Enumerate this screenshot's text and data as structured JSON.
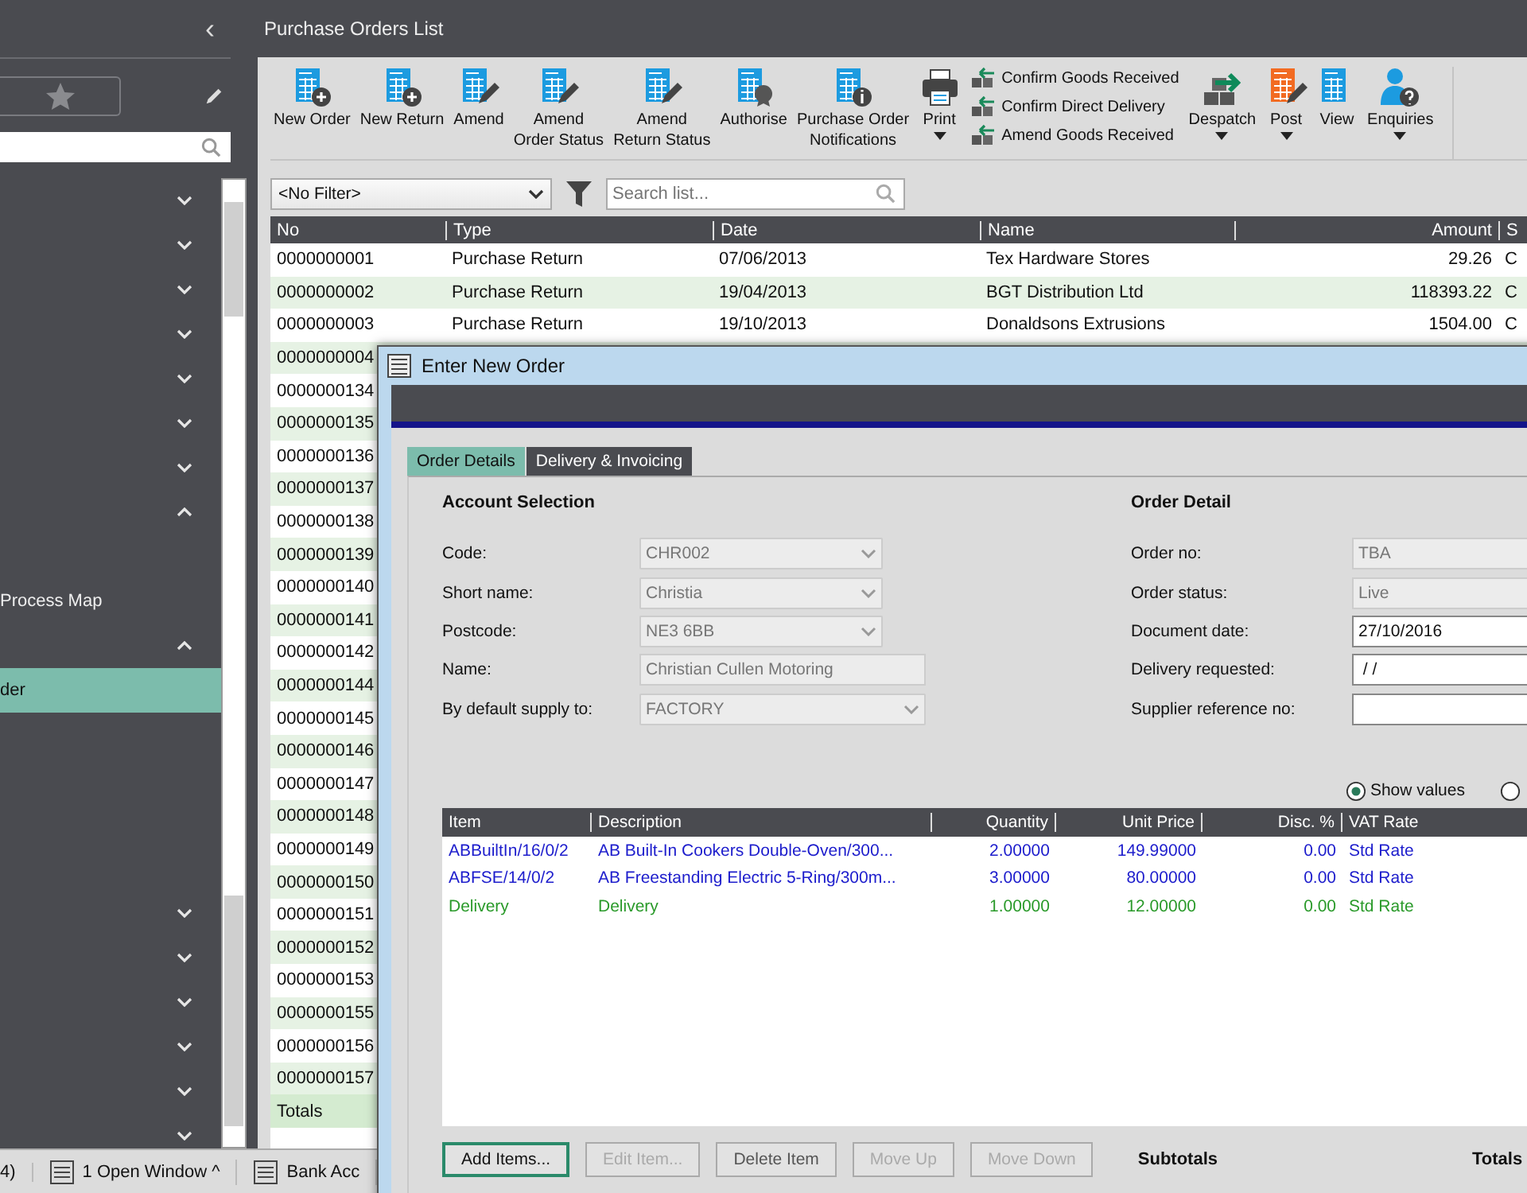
{
  "sidebar": {
    "collapse_glyph": "‹",
    "items": [
      {
        "expanded": false
      },
      {
        "expanded": false
      },
      {
        "expanded": false
      },
      {
        "expanded": false
      },
      {
        "expanded": false
      },
      {
        "expanded": false
      },
      {
        "expanded": false
      },
      {
        "expanded": true
      },
      {
        "selected": false
      },
      {
        "label": "Process Map",
        "selected": false
      },
      {
        "expanded": true
      },
      {
        "label": "der",
        "selected": true
      },
      {
        "selected": false
      },
      {
        "selected": false
      },
      {
        "selected": false
      },
      {
        "selected": false
      },
      {
        "expanded": false
      },
      {
        "expanded": false
      },
      {
        "expanded": false
      },
      {
        "expanded": false
      },
      {
        "expanded": false
      },
      {
        "expanded": false
      }
    ]
  },
  "window": {
    "title": "Purchase Orders List"
  },
  "toolbar": [
    {
      "kind": "new",
      "label": "New Order"
    },
    {
      "kind": "new",
      "label": "New Return"
    },
    {
      "kind": "amend",
      "label": "Amend"
    },
    {
      "kind": "amend",
      "label": "Amend\nOrder Status"
    },
    {
      "kind": "amend",
      "label": "Amend\nReturn Status"
    },
    {
      "kind": "authorise",
      "label": "Authorise"
    },
    {
      "kind": "info",
      "label": "Purchase Order\nNotifications"
    },
    {
      "kind": "print",
      "label": "Print",
      "menu": true
    },
    {
      "kind": "links",
      "links": [
        {
          "label": "Confirm Goods Received"
        },
        {
          "label": "Confirm Direct Delivery"
        },
        {
          "label": "Amend Goods Received"
        }
      ]
    },
    {
      "kind": "despatch",
      "label": "Despatch",
      "menu": true
    },
    {
      "kind": "post",
      "label": "Post",
      "menu": true
    },
    {
      "kind": "view",
      "label": "View"
    },
    {
      "kind": "enquiries",
      "label": "Enquiries",
      "menu": true
    }
  ],
  "filter": {
    "value": "<No Filter>"
  },
  "search": {
    "placeholder": "Search list..."
  },
  "table": {
    "columns": [
      "No",
      "Type",
      "Date",
      "Name",
      "Amount",
      "S"
    ],
    "rows": [
      {
        "no": "0000000001",
        "type": "Purchase Return",
        "date": "07/06/2013",
        "name": "Tex Hardware Stores",
        "amount": "29.26",
        "s": "C"
      },
      {
        "no": "0000000002",
        "type": "Purchase Return",
        "date": "19/04/2013",
        "name": "BGT Distribution Ltd",
        "amount": "118393.22",
        "s": "C"
      },
      {
        "no": "0000000003",
        "type": "Purchase Return",
        "date": "19/10/2013",
        "name": "Donaldsons Extrusions",
        "amount": "1504.00",
        "s": "C"
      },
      {
        "no": "0000000004"
      },
      {
        "no": "0000000134"
      },
      {
        "no": "0000000135"
      },
      {
        "no": "0000000136"
      },
      {
        "no": "0000000137"
      },
      {
        "no": "0000000138"
      },
      {
        "no": "0000000139"
      },
      {
        "no": "0000000140"
      },
      {
        "no": "0000000141"
      },
      {
        "no": "0000000142"
      },
      {
        "no": "0000000144"
      },
      {
        "no": "0000000145"
      },
      {
        "no": "0000000146"
      },
      {
        "no": "0000000147"
      },
      {
        "no": "0000000148"
      },
      {
        "no": "0000000149"
      },
      {
        "no": "0000000150"
      },
      {
        "no": "0000000151"
      },
      {
        "no": "0000000152"
      },
      {
        "no": "0000000153"
      },
      {
        "no": "0000000155"
      },
      {
        "no": "0000000156"
      },
      {
        "no": "0000000157"
      }
    ],
    "totals_label": "Totals"
  },
  "taskbar": [
    {
      "label": "4)"
    },
    {
      "label": "1 Open Window ^"
    },
    {
      "label": "Bank Acc"
    }
  ],
  "dialog": {
    "title": "Enter New Order",
    "tabs": [
      {
        "label": "Order Details",
        "selected": true
      },
      {
        "label": "Delivery & Invoicing",
        "selected": false
      }
    ],
    "left": {
      "heading": "Account Selection",
      "fields": [
        {
          "label": "Code:",
          "value": "CHR002",
          "kind": "dropdown",
          "disabled": true
        },
        {
          "label": "Short name:",
          "value": "Christia",
          "kind": "dropdown",
          "disabled": true
        },
        {
          "label": "Postcode:",
          "value": "NE3 6BB",
          "kind": "dropdown",
          "disabled": true
        },
        {
          "label": "Name:",
          "value": "Christian Cullen Motoring",
          "kind": "text",
          "disabled": true
        },
        {
          "label": "By default supply to:",
          "value": "FACTORY",
          "kind": "dropdown",
          "disabled": true
        }
      ]
    },
    "right": {
      "heading": "Order Detail",
      "fields": [
        {
          "label": "Order no:",
          "value": "TBA",
          "disabled": true
        },
        {
          "label": "Order status:",
          "value": "Live",
          "disabled": true
        },
        {
          "label": "Document date:",
          "value": "27/10/2016",
          "disabled": false
        },
        {
          "label": "Delivery requested:",
          "value": " / /",
          "disabled": false
        },
        {
          "label": "Supplier reference no:",
          "disabled": false
        }
      ]
    },
    "radios": [
      {
        "label": "Show values",
        "selected": true
      },
      {
        "selected": false
      }
    ],
    "grid": {
      "columns": [
        "Item",
        "Description",
        "Quantity",
        "Unit Price",
        "Disc. %",
        "VAT Rate"
      ],
      "rows": [
        {
          "item": "ABBuiltIn/16/0/2",
          "description": "AB Built-In Cookers Double-Oven/300...",
          "quantity": "2.00000",
          "unit_price": "149.99000",
          "disc": "0.00",
          "vat": "Std Rate",
          "color": "#1c1ccc"
        },
        {
          "item": "ABFSE/14/0/2",
          "description": "AB Freestanding Electric 5-Ring/300m...",
          "quantity": "3.00000",
          "unit_price": "80.00000",
          "disc": "0.00",
          "vat": "Std Rate",
          "color": "#1c1ccc"
        },
        {
          "item": "Delivery",
          "description": "Delivery",
          "quantity": "1.00000",
          "unit_price": "12.00000",
          "disc": "0.00",
          "vat": "Std Rate",
          "color": "#2a9a2a"
        }
      ]
    },
    "buttons": [
      {
        "label": "Add Items...",
        "focused": true,
        "disabled": false
      },
      {
        "label": "Edit Item...",
        "focused": false,
        "disabled": true
      },
      {
        "label": "Delete Item",
        "focused": false,
        "disabled": false
      },
      {
        "label": "Move Up",
        "focused": false,
        "disabled": true
      },
      {
        "label": "Move Down",
        "focused": false,
        "disabled": true
      }
    ],
    "summary": [
      "Subtotals",
      "Totals"
    ]
  }
}
